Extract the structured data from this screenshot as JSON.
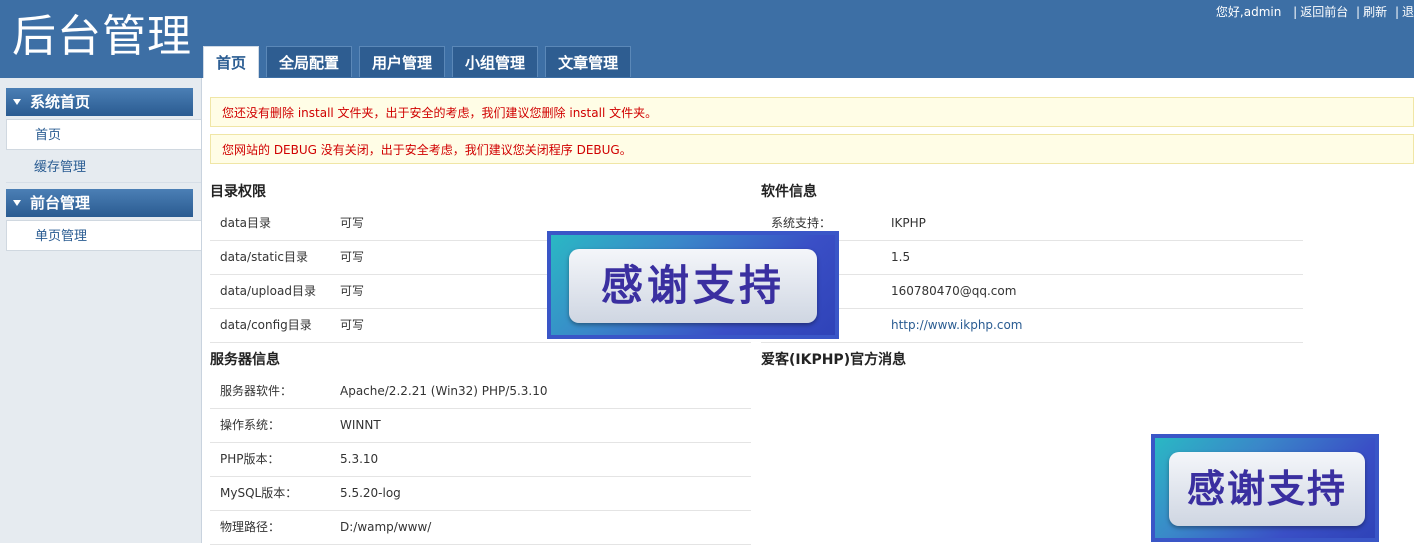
{
  "app": {
    "title": "后台管理"
  },
  "toplinks": {
    "greeting": "您好,admin",
    "front": "返回前台",
    "refresh": "刷新",
    "logout": "退"
  },
  "tabs": [
    {
      "label": "首页"
    },
    {
      "label": "全局配置"
    },
    {
      "label": "用户管理"
    },
    {
      "label": "小组管理"
    },
    {
      "label": "文章管理"
    }
  ],
  "sidebar": {
    "groups": [
      {
        "title": "系统首页",
        "items": [
          {
            "label": "首页"
          },
          {
            "label": "缓存管理"
          }
        ]
      },
      {
        "title": "前台管理",
        "items": [
          {
            "label": "单页管理"
          }
        ]
      }
    ]
  },
  "notices": [
    "您还没有删除 install 文件夹，出于安全的考虑，我们建议您删除 install 文件夹。",
    "您网站的 DEBUG 没有关闭，出于安全考虑，我们建议您关闭程序 DEBUG。"
  ],
  "dir_perms": {
    "title": "目录权限",
    "rows": [
      {
        "k": "data目录",
        "v": "可写"
      },
      {
        "k": "data/static目录",
        "v": "可写"
      },
      {
        "k": "data/upload目录",
        "v": "可写"
      },
      {
        "k": "data/config目录",
        "v": "可写"
      }
    ]
  },
  "software": {
    "title": "软件信息",
    "rows": [
      {
        "k": "系统支持：",
        "v": "IKPHP"
      },
      {
        "k": "",
        "v": "1.5"
      },
      {
        "k": "",
        "v": "160780470@qq.com"
      },
      {
        "k": "",
        "v": "http://www.ikphp.com"
      }
    ]
  },
  "server": {
    "title": "服务器信息",
    "rows": [
      {
        "k": "服务器软件：",
        "v": "Apache/2.2.21 (Win32) PHP/5.3.10"
      },
      {
        "k": "操作系统：",
        "v": "WINNT"
      },
      {
        "k": "PHP版本：",
        "v": "5.3.10"
      },
      {
        "k": "MySQL版本：",
        "v": "5.5.20-log"
      },
      {
        "k": "物理路径：",
        "v": "D:/wamp/www/"
      }
    ]
  },
  "news": {
    "title": "爱客(IKPHP)官方消息"
  },
  "banner": {
    "text": "感谢支持"
  }
}
